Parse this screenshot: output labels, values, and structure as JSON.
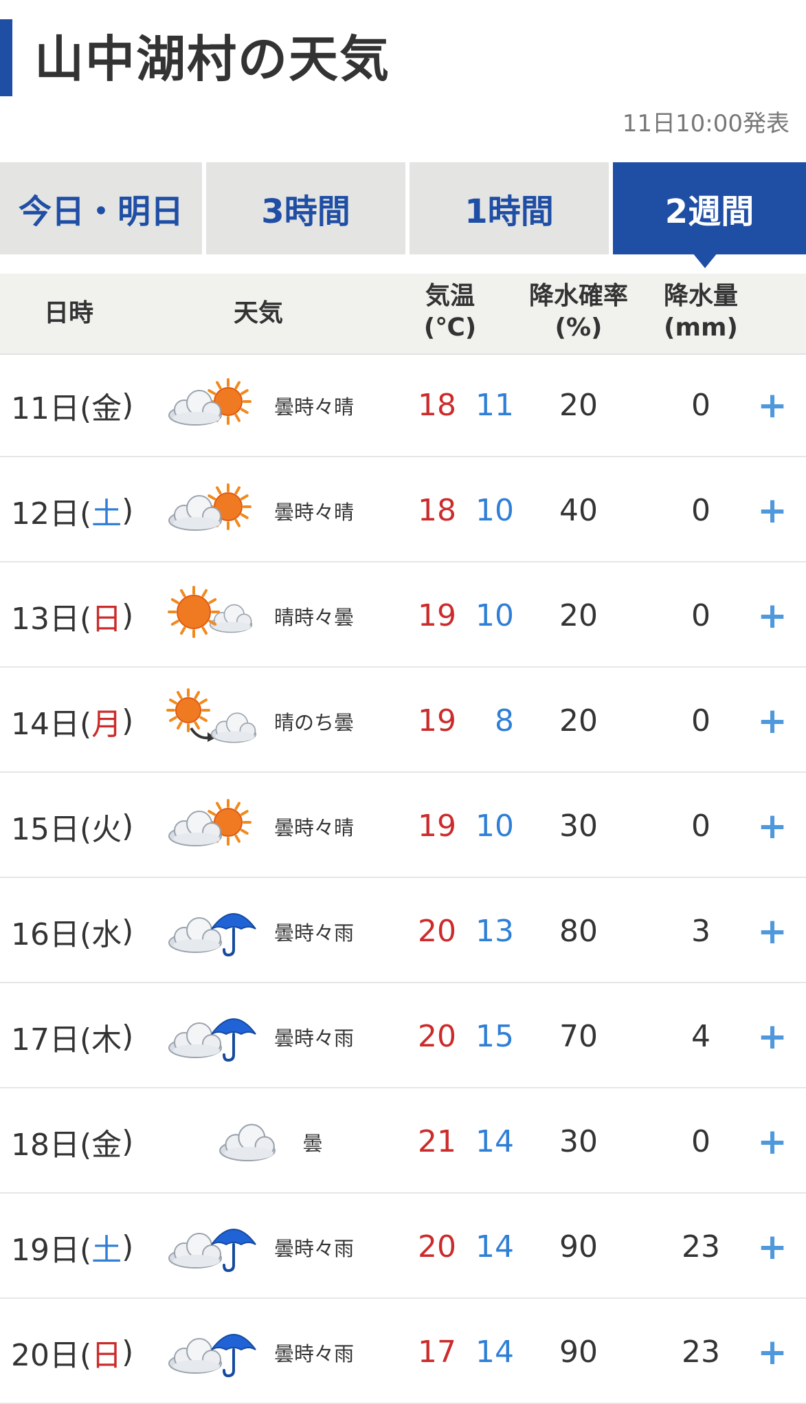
{
  "header": {
    "title": "山中湖村の天気",
    "issued": "11日10:00発表"
  },
  "tabs": [
    {
      "label": "今日・明日",
      "active": false
    },
    {
      "label": "3時間",
      "active": false
    },
    {
      "label": "1時間",
      "active": false
    },
    {
      "label": "2週間",
      "active": true
    }
  ],
  "table_header": {
    "date": "日時",
    "weather": "天気",
    "temp_line1": "気温",
    "temp_line2": "(℃)",
    "pop_line1": "降水確率",
    "pop_line2": "(%)",
    "amount_line1": "降水量",
    "amount_line2": "(mm)"
  },
  "rows": [
    {
      "date": "11日(",
      "wd": "金",
      "close": ")",
      "wd_color": "normal",
      "icon": "cloudy-sometimes-sunny-icon",
      "weather": "曇時々晴",
      "high": "18",
      "low": "11",
      "pop": "20",
      "amount": "0",
      "expand": "+"
    },
    {
      "date": "12日(",
      "wd": "土",
      "close": ")",
      "wd_color": "blue",
      "icon": "cloudy-sometimes-sunny-icon",
      "weather": "曇時々晴",
      "high": "18",
      "low": "10",
      "pop": "40",
      "amount": "0",
      "expand": "+"
    },
    {
      "date": "13日(",
      "wd": "日",
      "close": ")",
      "wd_color": "red",
      "icon": "sunny-sometimes-cloudy-icon",
      "weather": "晴時々曇",
      "high": "19",
      "low": "10",
      "pop": "20",
      "amount": "0",
      "expand": "+"
    },
    {
      "date": "14日(",
      "wd": "月",
      "close": ")",
      "wd_color": "red",
      "icon": "sunny-then-cloudy-icon",
      "weather": "晴のち曇",
      "high": "19",
      "low": "8",
      "pop": "20",
      "amount": "0",
      "expand": "+"
    },
    {
      "date": "15日(",
      "wd": "火",
      "close": ")",
      "wd_color": "normal",
      "icon": "cloudy-sometimes-sunny-icon",
      "weather": "曇時々晴",
      "high": "19",
      "low": "10",
      "pop": "30",
      "amount": "0",
      "expand": "+"
    },
    {
      "date": "16日(",
      "wd": "水",
      "close": ")",
      "wd_color": "normal",
      "icon": "cloudy-sometimes-rain-icon",
      "weather": "曇時々雨",
      "high": "20",
      "low": "13",
      "pop": "80",
      "amount": "3",
      "expand": "+"
    },
    {
      "date": "17日(",
      "wd": "木",
      "close": ")",
      "wd_color": "normal",
      "icon": "cloudy-sometimes-rain-icon",
      "weather": "曇時々雨",
      "high": "20",
      "low": "15",
      "pop": "70",
      "amount": "4",
      "expand": "+"
    },
    {
      "date": "18日(",
      "wd": "金",
      "close": ")",
      "wd_color": "normal",
      "icon": "cloudy-icon",
      "weather": "曇",
      "high": "21",
      "low": "14",
      "pop": "30",
      "amount": "0",
      "expand": "+"
    },
    {
      "date": "19日(",
      "wd": "土",
      "close": ")",
      "wd_color": "blue",
      "icon": "cloudy-sometimes-rain-icon",
      "weather": "曇時々雨",
      "high": "20",
      "low": "14",
      "pop": "90",
      "amount": "23",
      "expand": "+"
    },
    {
      "date": "20日(",
      "wd": "日",
      "close": ")",
      "wd_color": "red",
      "icon": "cloudy-sometimes-rain-icon",
      "weather": "曇時々雨",
      "high": "17",
      "low": "14",
      "pop": "90",
      "amount": "23",
      "expand": "+"
    }
  ],
  "colors": {
    "brand_blue": "#1f4ea5",
    "high_temp": "#cc2b2b",
    "low_temp": "#2f7fd6",
    "expand_plus": "#4e98db"
  }
}
